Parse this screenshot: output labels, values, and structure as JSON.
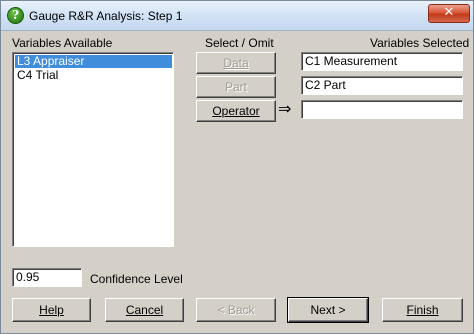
{
  "window": {
    "title": "Gauge R&R Analysis: Step 1",
    "app_icon_glyph": "?",
    "close_glyph": "✕"
  },
  "variables_available": {
    "label": "Variables Available",
    "items": [
      {
        "label": "L3 Appraiser",
        "selected": true
      },
      {
        "label": "C4 Trial",
        "selected": false
      }
    ]
  },
  "select_omit": {
    "label": "Select / Omit",
    "buttons": [
      {
        "id": "data",
        "label": "Data",
        "enabled": false
      },
      {
        "id": "part",
        "label": "Part",
        "enabled": false
      },
      {
        "id": "operator",
        "label": "Operator",
        "enabled": true
      }
    ],
    "arrow_glyph": "⇒"
  },
  "variables_selected": {
    "label": "Variables Selected",
    "fields": [
      "C1 Measurement",
      "C2 Part",
      ""
    ]
  },
  "confidence": {
    "value": "0.95",
    "label": "Confidence Level"
  },
  "footer_buttons": {
    "help": "Help",
    "cancel": "Cancel",
    "back": "< Back",
    "next": "Next >",
    "finish": "Finish"
  },
  "colors": {
    "dialog_bg": "#d4d0c8",
    "selection": "#3f8ddb",
    "close_button": "#d9573a"
  }
}
